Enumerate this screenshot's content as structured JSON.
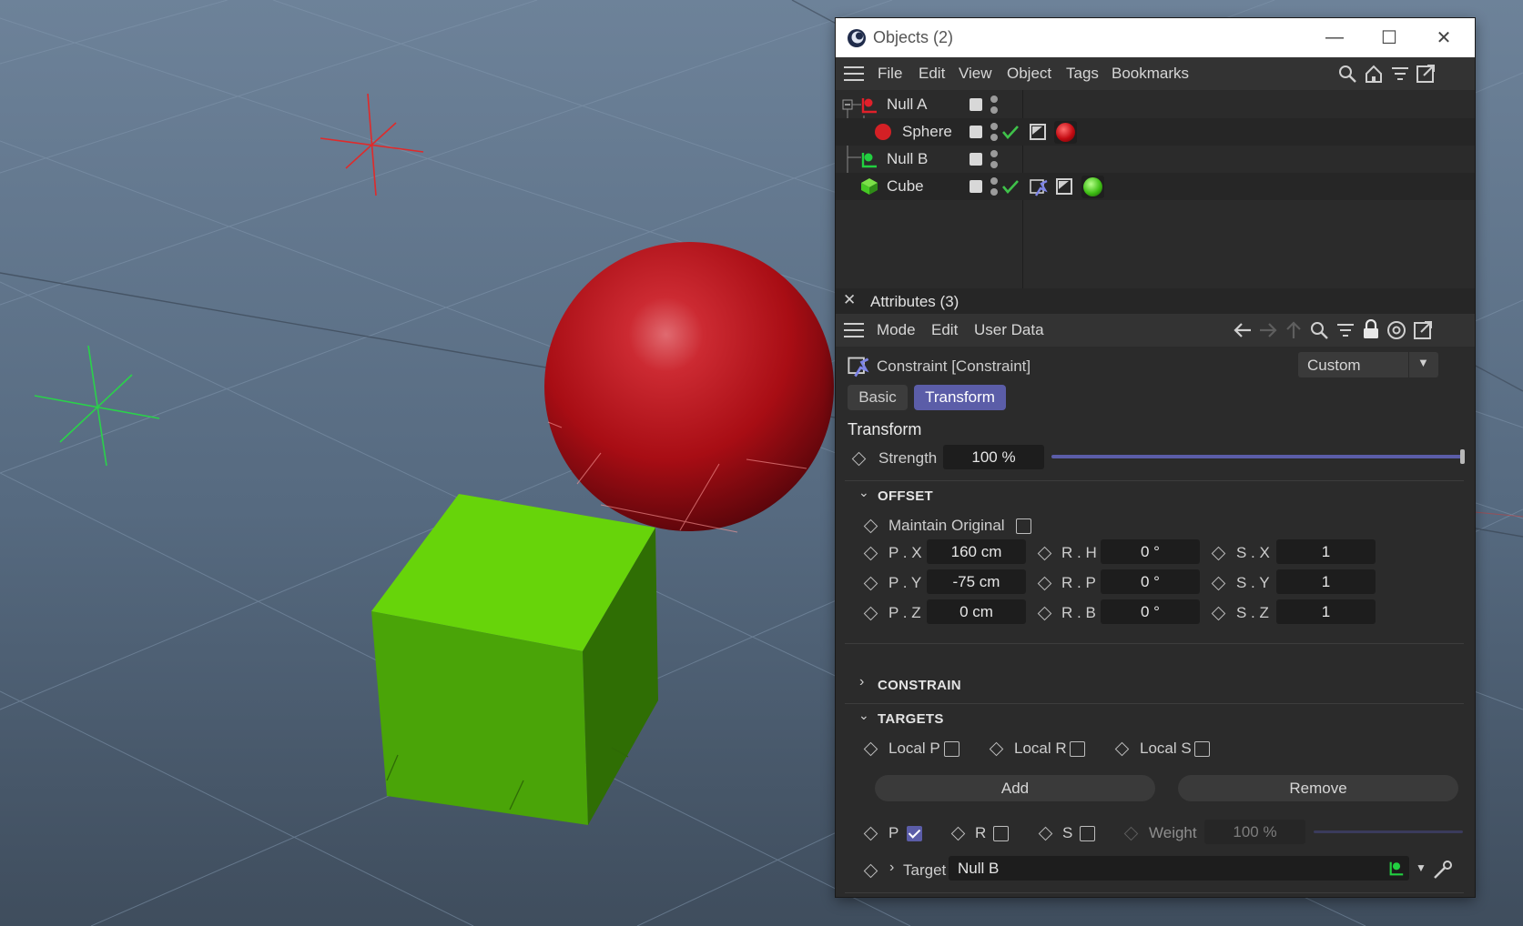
{
  "window": {
    "title": "Objects (2)",
    "buttons": {
      "minimize": "—",
      "maximize": "☐",
      "close": "✕"
    }
  },
  "objects_menu": {
    "items": [
      "File",
      "Edit",
      "View",
      "Object",
      "Tags",
      "Bookmarks"
    ],
    "icons": [
      "search-icon",
      "home-icon",
      "filter-icon",
      "new-window-icon"
    ]
  },
  "objects": [
    {
      "name": "Null A",
      "icon": "null-icon",
      "color": "#e0202a"
    },
    {
      "name": "Sphere",
      "icon": "sphere-icon",
      "color": "#d42025",
      "material": "red"
    },
    {
      "name": "Null B",
      "icon": "null-icon",
      "color": "#22d040"
    },
    {
      "name": "Cube",
      "icon": "cube-icon",
      "color": "#46c824",
      "material": "green"
    }
  ],
  "attributes": {
    "title": "Attributes (3)",
    "menu": [
      "Mode",
      "Edit",
      "User Data"
    ],
    "object_title": "Constraint [Constraint]",
    "preset": "Custom",
    "tabs": {
      "basic": "Basic",
      "transform": "Transform"
    },
    "section_title": "Transform",
    "strength": {
      "label": "Strength",
      "value": "100 %",
      "fraction": 1.0
    },
    "offset": {
      "header": "OFFSET",
      "maintain_original": "Maintain Original",
      "rows": [
        {
          "pl": "P . X",
          "pv": "160 cm",
          "rl": "R . H",
          "rv": "0 °",
          "sl": "S . X",
          "sv": "1"
        },
        {
          "pl": "P . Y",
          "pv": "-75 cm",
          "rl": "R . P",
          "rv": "0 °",
          "sl": "S . Y",
          "sv": "1"
        },
        {
          "pl": "P . Z",
          "pv": "0 cm",
          "rl": "R . B",
          "rv": "0 °",
          "sl": "S . Z",
          "sv": "1"
        }
      ]
    },
    "constrain": {
      "header": "CONSTRAIN"
    },
    "targets": {
      "header": "TARGETS",
      "local_p": "Local P",
      "local_r": "Local R",
      "local_s": "Local S",
      "add": "Add",
      "remove": "Remove",
      "p": "P",
      "r": "R",
      "s": "S",
      "weight": {
        "label": "Weight",
        "value": "100 %"
      },
      "target": {
        "label": "Target",
        "value": "Null B"
      }
    }
  },
  "accent_color": "#5b5da8"
}
